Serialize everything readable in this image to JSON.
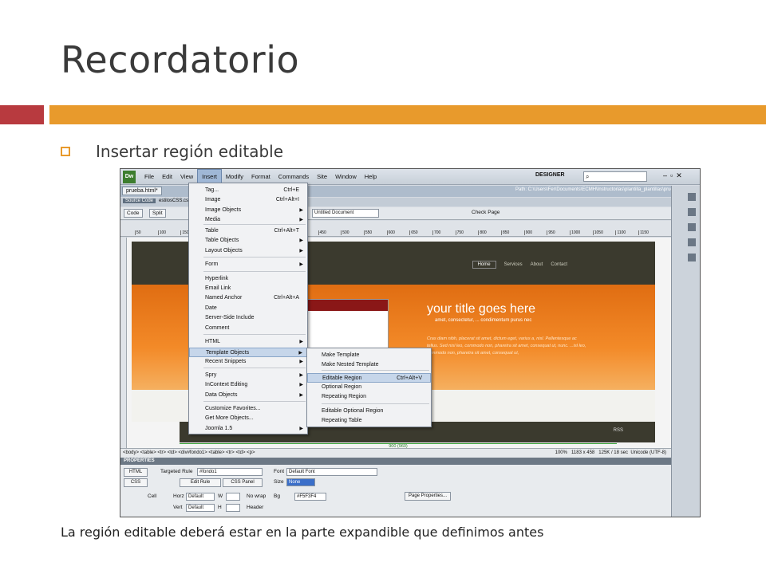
{
  "slide": {
    "title": "Recordatorio",
    "bullet": "Insertar región editable",
    "caption": "La región editable deberá estar en la parte expandible que definimos antes"
  },
  "app": {
    "logo": "Dw",
    "menus": [
      "File",
      "Edit",
      "View",
      "Insert",
      "Modify",
      "Format",
      "Commands",
      "Site",
      "Window",
      "Help"
    ],
    "active_menu": "Insert",
    "workspace": "DESIGNER",
    "search_icon": "search-icon",
    "document_tab": "prueba.html*",
    "path_label": "Path: C:\\Users\\Fer\\Documents\\ECMH\\Instructorias\\plantilla_plantillas\\prueba.html",
    "source_code_label": "Source Code",
    "source_file": "estilosCSS.css",
    "toolbar": {
      "code": "Code",
      "split": "Split",
      "title_value": "Untitled Document",
      "check_page": "Check Page"
    },
    "ruler_ticks": [
      "50",
      "100",
      "150",
      "200",
      "250",
      "300",
      "350",
      "400",
      "450",
      "500",
      "550",
      "600",
      "650",
      "700",
      "750",
      "800",
      "850",
      "900",
      "950",
      "1000",
      "1050",
      "1100",
      "1150"
    ],
    "site": {
      "nav": [
        "Home",
        "Services",
        "About",
        "Contact"
      ],
      "hero_title": "your title goes here",
      "hero_sub": "amet, consectetur, ... condimentum purus nec",
      "hero_text": "Cras diam nibh, placerat sit amet, dictum eget, varius a, nisl. Pellentesque ac tellus. Sed nisl leo, commodo non, pharetra sit amet, consequat ut, nunc. ...isl leo, commodo non, pharetra sit amet, consequat ut,",
      "rss": "RSS",
      "width_label": "900 (960)"
    },
    "status_bar": {
      "tags": "<body> <table> <tr> <td> <div#fondo1> <table> <tr> <td> <p>",
      "zoom": "100%",
      "size": "1183 x 458",
      "weight": "125K / 18 sec",
      "encoding": "Unicode (UTF-8)"
    },
    "properties": {
      "header": "PROPERTIES",
      "html": "HTML",
      "css": "CSS",
      "targeted_rule_label": "Targeted Rule",
      "targeted_rule_value": "#fondo1",
      "edit_rule": "Edit Rule",
      "css_panel": "CSS Panel",
      "font_label": "Font",
      "font_value": "Default Font",
      "size_label": "Size",
      "size_value": "None",
      "cell": "Cell",
      "horz_label": "Horz",
      "horz_value": "Default",
      "vert_label": "Vert",
      "vert_value": "Default",
      "w_label": "W",
      "h_label": "H",
      "nowrap_label": "No wrap",
      "header_label": "Header",
      "bg_label": "Bg",
      "bg_value": "#F5F3F4",
      "page_properties": "Page Properties..."
    }
  },
  "insert_menu": [
    {
      "label": "Tag...",
      "shortcut": "Ctrl+E"
    },
    {
      "label": "Image",
      "shortcut": "Ctrl+Alt+I"
    },
    {
      "label": "Image Objects",
      "arrow": true
    },
    {
      "label": "Media",
      "arrow": true
    },
    {
      "label": "Table",
      "shortcut": "Ctrl+Alt+T"
    },
    {
      "label": "Table Objects",
      "arrow": true
    },
    {
      "label": "Layout Objects",
      "arrow": true
    },
    {
      "label": "Form",
      "arrow": true
    },
    {
      "label": "Hyperlink"
    },
    {
      "label": "Email Link"
    },
    {
      "label": "Named Anchor",
      "shortcut": "Ctrl+Alt+A"
    },
    {
      "label": "Date"
    },
    {
      "label": "Server-Side Include"
    },
    {
      "label": "Comment"
    },
    {
      "label": "HTML",
      "arrow": true
    },
    {
      "label": "Template Objects",
      "arrow": true
    },
    {
      "label": "Recent Snippets",
      "arrow": true
    },
    {
      "label": "Spry",
      "arrow": true
    },
    {
      "label": "InContext Editing",
      "arrow": true
    },
    {
      "label": "Data Objects",
      "arrow": true
    },
    {
      "label": "Customize Favorites..."
    },
    {
      "label": "Get More Objects..."
    },
    {
      "label": "Joomla 1.5",
      "arrow": true
    }
  ],
  "template_menu": [
    {
      "label": "Make Template"
    },
    {
      "label": "Make Nested Template"
    },
    {
      "label": "Editable Region",
      "shortcut": "Ctrl+Alt+V"
    },
    {
      "label": "Optional Region"
    },
    {
      "label": "Repeating Region"
    },
    {
      "label": "Editable Optional Region"
    },
    {
      "label": "Repeating Table"
    }
  ],
  "colors": {
    "accent_red": "#b83a3f",
    "accent_orange": "#e89a2c",
    "highlight": "#c6d6ea"
  }
}
